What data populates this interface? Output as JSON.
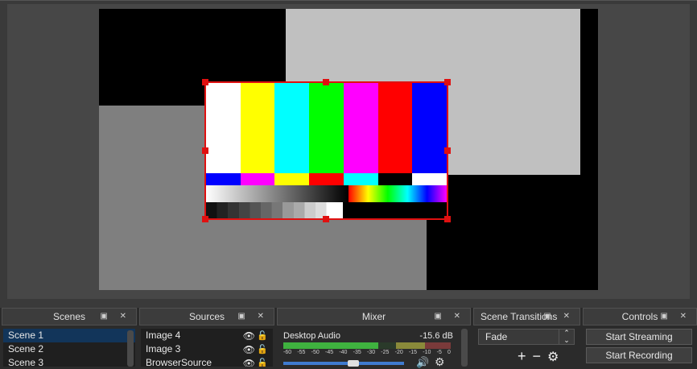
{
  "docks": {
    "scenes": {
      "title": "Scenes",
      "items": [
        "Scene 1",
        "Scene 2",
        "Scene 3"
      ]
    },
    "sources": {
      "title": "Sources",
      "items": [
        "Image 4",
        "Image 3",
        "BrowserSource"
      ]
    },
    "mixer": {
      "title": "Mixer",
      "channel": "Desktop Audio",
      "level": "-15.6 dB",
      "scale": [
        "-60",
        "-55",
        "-50",
        "-45",
        "-40",
        "-35",
        "-30",
        "-25",
        "-20",
        "-15",
        "-10",
        "-5",
        "0"
      ]
    },
    "transitions": {
      "title": "Scene Transitions",
      "selected": "Fade"
    },
    "controls": {
      "title": "Controls",
      "start_streaming": "Start Streaming",
      "start_recording": "Start Recording"
    }
  },
  "dock_buttons": "▣ ✕",
  "colors": {
    "selection": "#e01010",
    "accent": "#12355a"
  }
}
